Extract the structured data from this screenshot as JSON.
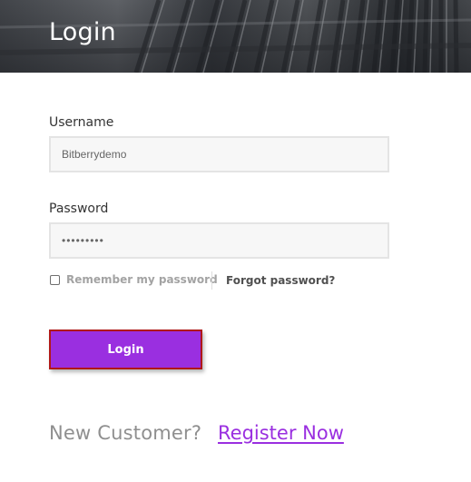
{
  "header": {
    "title": "Login"
  },
  "form": {
    "username": {
      "label": "Username",
      "value": "Bitberrydemo"
    },
    "password": {
      "label": "Password",
      "value": "•••••••••"
    },
    "remember": {
      "label": "Remember my password",
      "checked": false
    },
    "forgot_label": "Forgot password?",
    "submit_label": "Login"
  },
  "footer": {
    "prompt": "New Customer?",
    "register_label": "Register Now"
  },
  "colors": {
    "accent": "#9a2fe0",
    "button_border": "#b01818"
  }
}
